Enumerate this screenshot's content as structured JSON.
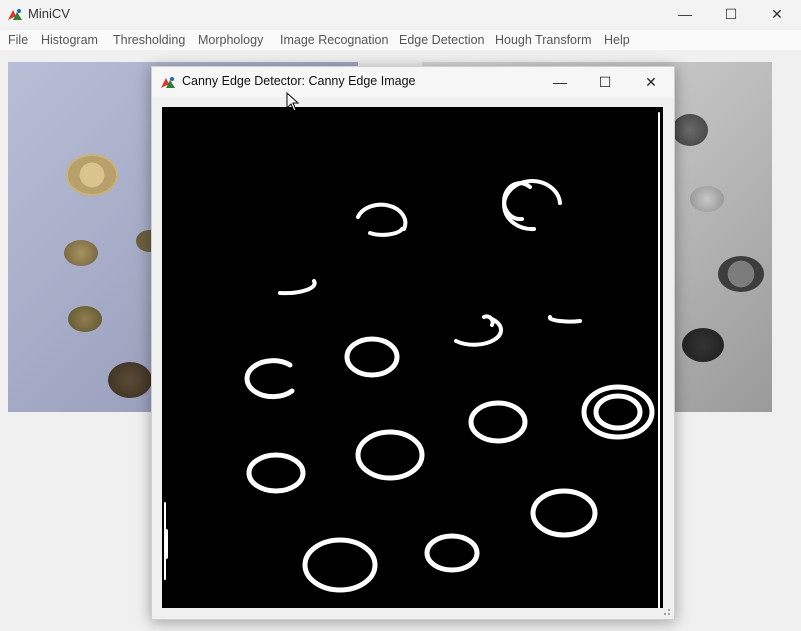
{
  "main_window": {
    "title": "MiniCV",
    "controls": {
      "minimize": "—",
      "maximize": "☐",
      "close": "✕"
    }
  },
  "menu": [
    {
      "label": "File"
    },
    {
      "label": "Histogram"
    },
    {
      "label": "Thresholding"
    },
    {
      "label": "Morphology"
    },
    {
      "label": "Image Recognation"
    },
    {
      "label": "Edge Detection"
    },
    {
      "label": "Hough Transform"
    },
    {
      "label": "Help"
    }
  ],
  "dialog": {
    "title": "Canny Edge Detector: Canny Edge Image",
    "controls": {
      "minimize": "—",
      "maximize": "☐",
      "close": "✕"
    }
  },
  "icons": {
    "app": "app-icon",
    "cursor": "mouse-pointer-icon"
  },
  "colors": {
    "edge_background": "#000000",
    "edge_lines": "#ffffff",
    "left_photo_tint": "#a6acc7",
    "right_photo_tint": "#bdbdbd"
  }
}
